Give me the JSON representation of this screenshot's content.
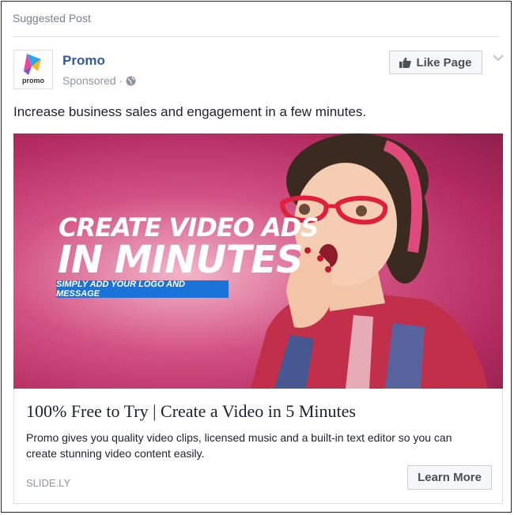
{
  "header": {
    "suggested_label": "Suggested Post"
  },
  "page": {
    "name": "Promo",
    "logo_word": "promo",
    "sponsored_label": "Sponsored",
    "separator": "·",
    "like_button_label": "Like Page"
  },
  "post": {
    "text": "Increase business sales and engagement in a few minutes."
  },
  "hero": {
    "title_line1": "CREATE VIDEO ADS",
    "title_line2": "IN MINUTES",
    "subtitle": "SIMPLY ADD YOUR LOGO AND MESSAGE"
  },
  "link_card": {
    "headline": "100% Free to Try | Create a Video in 5 Minutes",
    "description": "Promo gives you quality video clips, licensed music and a built-in text editor so you can create stunning video content easily.",
    "domain": "SLIDE.LY",
    "cta_label": "Learn More"
  },
  "icons": {
    "globe": "globe-icon",
    "like": "thumbs-up-icon",
    "menu": "chevron-down-icon",
    "logo": "promo-logo"
  },
  "colors": {
    "link_blue": "#365899",
    "muted_text": "#90949c",
    "button_bg": "#f6f7f9",
    "hero_accent": "#1a73d9",
    "hero_pink": "#d25183"
  }
}
